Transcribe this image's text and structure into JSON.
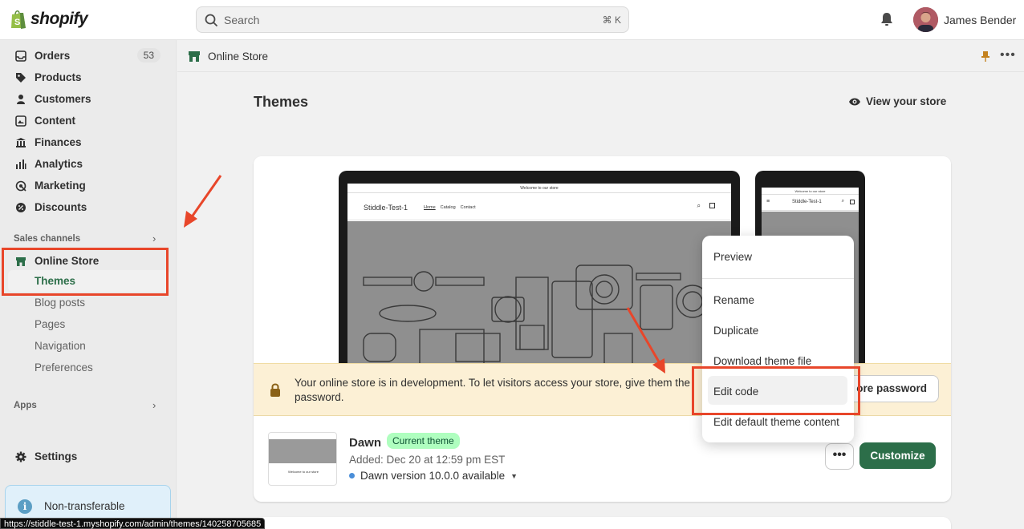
{
  "app": {
    "brand": "shopify"
  },
  "topbar": {
    "search_placeholder": "Search",
    "search_shortcut": "⌘ K",
    "user_name": "James Bender"
  },
  "sidebar": {
    "items": [
      {
        "label": "Orders",
        "icon": "inbox-icon",
        "badge": "53"
      },
      {
        "label": "Products",
        "icon": "tag-icon"
      },
      {
        "label": "Customers",
        "icon": "person-icon"
      },
      {
        "label": "Content",
        "icon": "image-icon"
      },
      {
        "label": "Finances",
        "icon": "bank-icon"
      },
      {
        "label": "Analytics",
        "icon": "bar-chart-icon"
      },
      {
        "label": "Marketing",
        "icon": "target-icon"
      },
      {
        "label": "Discounts",
        "icon": "discount-icon"
      }
    ],
    "sales_channels_label": "Sales channels",
    "online_store": {
      "label": "Online Store",
      "sub_items": [
        "Themes",
        "Blog posts",
        "Pages",
        "Navigation",
        "Preferences"
      ]
    },
    "apps_label": "Apps",
    "settings_label": "Settings",
    "notice_text": "Non-transferable"
  },
  "breadcrumb": {
    "label": "Online Store"
  },
  "page": {
    "title": "Themes",
    "view_store_label": "View your store"
  },
  "preview": {
    "announcement": "Welcome to our store",
    "store_name": "Stiddle-Test-1",
    "nav_links": [
      "Home",
      "Catalog",
      "Contact"
    ]
  },
  "dev_banner": {
    "message": "Your online store is in development. To let visitors access your store, give them the password.",
    "button_label": "ore password"
  },
  "theme": {
    "name": "Dawn",
    "badge": "Current theme",
    "added": "Added: Dec 20 at 12:59 pm EST",
    "version": "Dawn version 10.0.0 available",
    "more_label": "•••",
    "customize_label": "Customize"
  },
  "menu": {
    "items": [
      "Preview",
      "Rename",
      "Duplicate",
      "Download theme file",
      "Edit code",
      "Edit default theme content"
    ]
  },
  "status_url": "https://stiddle-test-1.myshopify.com/admin/themes/140258705685",
  "colors": {
    "accent": "#2c6e49",
    "annotation_red": "#e8462a",
    "banner_bg": "#fcf0d5"
  }
}
